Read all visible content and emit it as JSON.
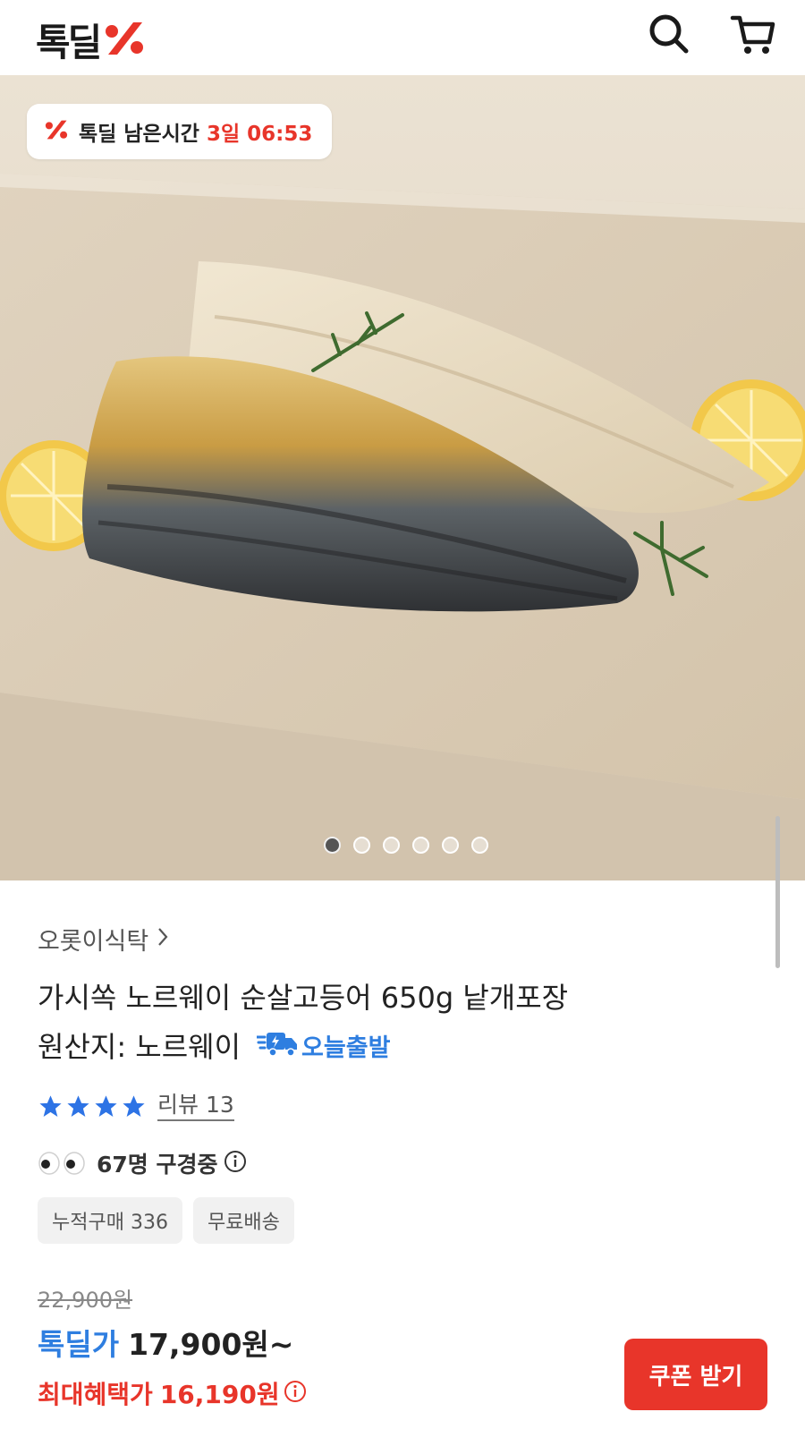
{
  "header": {
    "logo_text": "톡딜",
    "logo_icon": "percent-mark-icon",
    "search_icon": "search-icon",
    "cart_icon": "cart-icon"
  },
  "hero": {
    "timer_label": "톡딜 남은시간",
    "timer_value": "3일 06:53",
    "image_count": 6,
    "active_index": 0
  },
  "product": {
    "seller": "오롯이식탁",
    "title": "가시쏙 노르웨이 순살고등어 650g 낱개포장",
    "origin": "원산지: 노르웨이",
    "shipping_badge": "오늘출발",
    "rating_stars": 4,
    "review_label": "리뷰 13",
    "viewing": "67명 구경중",
    "tags": [
      "누적구매 336",
      "무료배송"
    ]
  },
  "price": {
    "original": "22,900원",
    "deal_label": "톡딜가",
    "deal_price": "17,900원~",
    "max_label": "최대혜택가",
    "max_price": "16,190원"
  },
  "actions": {
    "coupon_label": "쿠폰 받기"
  },
  "colors": {
    "brand_red": "#e8352a",
    "accent_blue": "#2e7ee0",
    "star_blue": "#2d73e5"
  }
}
